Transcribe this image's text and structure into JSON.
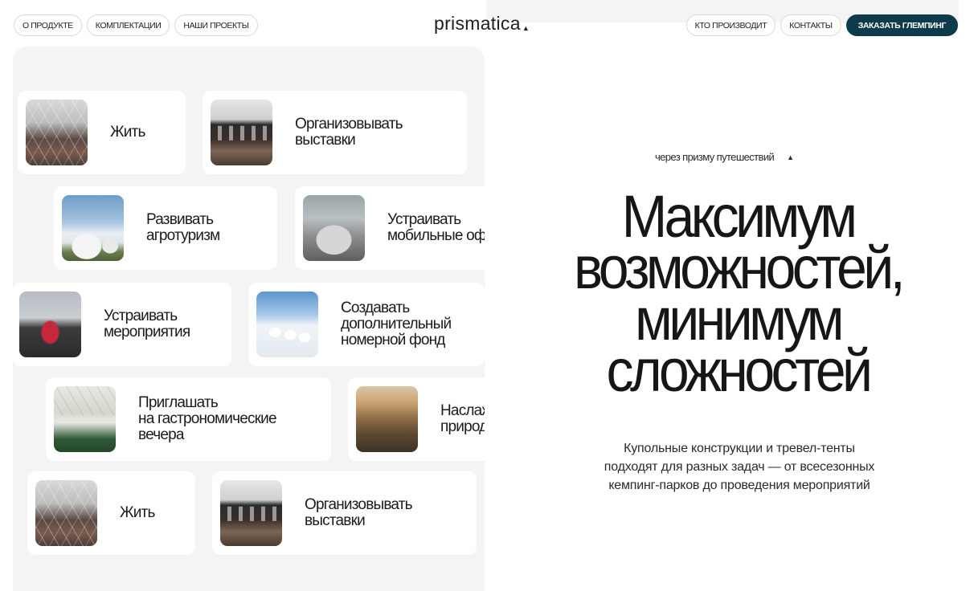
{
  "header": {
    "nav_left": [
      "О ПРОДУКТЕ",
      "КОМПЛЕКТАЦИИ",
      "НАШИ ПРОЕКТЫ"
    ],
    "logo": "prismatica",
    "logo_mark": "▲",
    "nav_right": [
      "КТО ПРОИЗВОДИТ",
      "КОНТАКТЫ"
    ],
    "cta": "ЗАКАЗАТЬ ГЛЕМПИНГ"
  },
  "gallery": {
    "cards": [
      {
        "label": "Жить",
        "image": "dome-interior-photo"
      },
      {
        "label": "Организовывать\nвыставки",
        "image": "dome-gallery-photo"
      },
      {
        "label": "Развивать\nагротуризм",
        "image": "domes-field-photo"
      },
      {
        "label": "Устраивать\nмобильные офисы",
        "image": "dome-grey-photo"
      },
      {
        "label": "Устраивать\nмероприятия",
        "image": "event-dome-photo"
      },
      {
        "label": "Создавать\nдополнительный\nномерной фонд",
        "image": "snow-domes-photo"
      },
      {
        "label": "Приглашать\nна гастрономические\nвечера",
        "image": "gastro-dome-photo"
      },
      {
        "label": "Наслаждаться\nприродой",
        "image": "nature-sunset-photo"
      },
      {
        "label": "Жить",
        "image": "dome-interior-photo"
      },
      {
        "label": "Организовывать\nвыставки",
        "image": "dome-gallery-photo"
      }
    ]
  },
  "hero": {
    "eyebrow": "через призму путешествий",
    "eyebrow_mark": "▲",
    "headline": [
      "Максимум",
      "возможностей,",
      "минимум",
      "сложностей"
    ],
    "subtext": [
      "Купольные конструкции и тревел-тенты",
      "подходят для разных задач — от всесезонных",
      "кемпинг-парков до проведения мероприятий"
    ]
  },
  "colors": {
    "accent": "#0d3b4c",
    "gallery_bg": "#f4f4f4",
    "text": "#1b1b1b"
  }
}
